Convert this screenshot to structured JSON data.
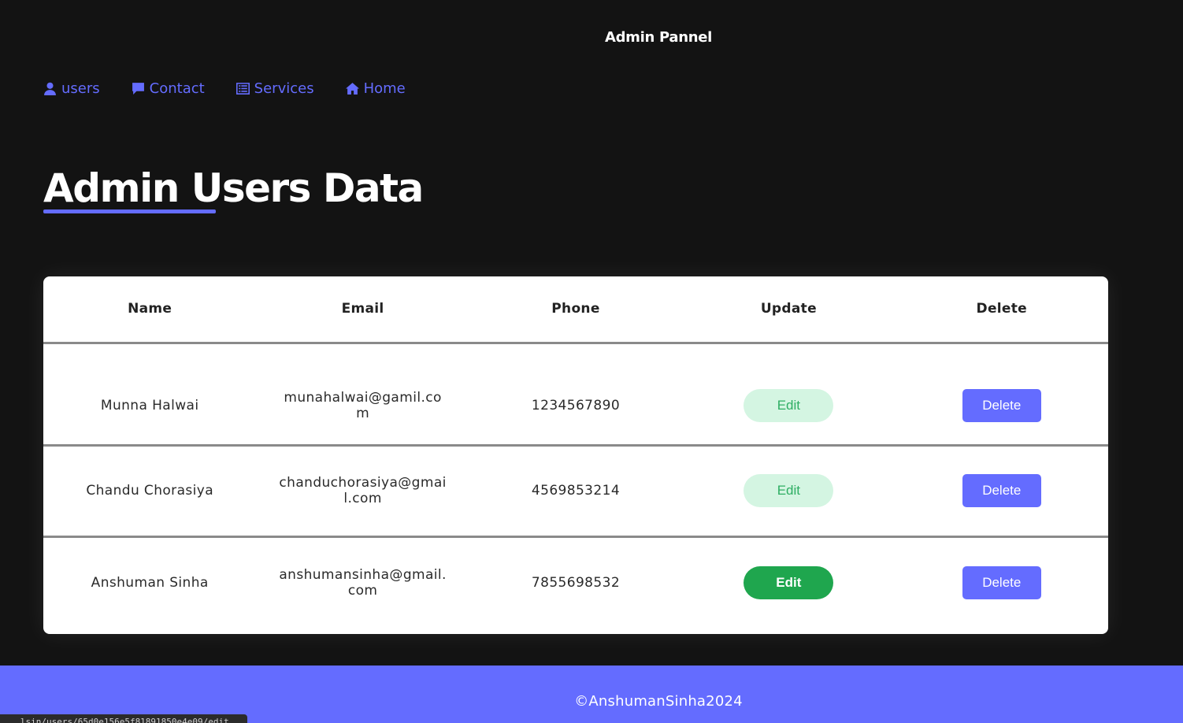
{
  "header": {
    "title": "Admin Pannel"
  },
  "nav": {
    "items": [
      {
        "label": "users",
        "icon": "user-icon"
      },
      {
        "label": "Contact",
        "icon": "message-icon"
      },
      {
        "label": "Services",
        "icon": "list-icon"
      },
      {
        "label": "Home",
        "icon": "home-icon"
      }
    ]
  },
  "page": {
    "title": "Admin Users Data"
  },
  "table": {
    "columns": [
      "Name",
      "Email",
      "Phone",
      "Update",
      "Delete"
    ],
    "rows": [
      {
        "name": "Munna Halwai",
        "email": "munahalwai@gamil.com",
        "phone": "1234567890",
        "edit_label": "Edit",
        "delete_label": "Delete"
      },
      {
        "name": "Chandu Chorasiya",
        "email": "chanduchorasiya@gmail.com",
        "phone": "4569853214",
        "edit_label": "Edit",
        "delete_label": "Delete"
      },
      {
        "name": "Anshuman Sinha",
        "email": "anshumansinha@gmail.com",
        "phone": "7855698532",
        "edit_label": "Edit",
        "delete_label": "Delete"
      }
    ]
  },
  "footer": {
    "text": "©AnshumanSinha2024"
  },
  "status_bar": {
    "url": "...lsin/users/65d0e156e5f81891850e4e09/edit"
  },
  "colors": {
    "accent": "#646cff",
    "background": "#131313",
    "edit_active": "#1fa64e",
    "edit_light": "#d4f5e2"
  }
}
